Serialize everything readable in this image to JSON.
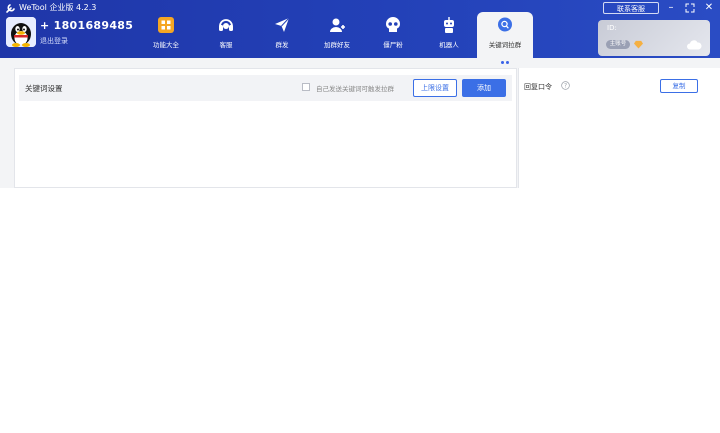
{
  "window": {
    "title": "WeTool 企业版 4.2.3",
    "contact_button": "联系客服",
    "controls": [
      "minimize",
      "maximize",
      "close"
    ]
  },
  "user": {
    "phone": "+ 1801689485",
    "logout_label": "退出登录"
  },
  "nav": {
    "items": [
      {
        "label": "功能大全",
        "icon": "grid-icon"
      },
      {
        "label": "客服",
        "icon": "headset-icon"
      },
      {
        "label": "群发",
        "icon": "paper-plane-icon"
      },
      {
        "label": "加群好友",
        "icon": "add-user-icon"
      },
      {
        "label": "僵尸粉",
        "icon": "skull-icon"
      },
      {
        "label": "机器人",
        "icon": "robot-icon"
      },
      {
        "label": "关键词拉群",
        "icon": "keyword-chat-icon",
        "active": true
      }
    ]
  },
  "account": {
    "id_label": "ID:",
    "badge": "主账号"
  },
  "keyword_panel": {
    "title": "关键词设置",
    "checkbox_label": "自己发送关键词可触发拉群",
    "checkbox_checked": false,
    "limit_button": "上限设置",
    "add_button": "添加"
  },
  "reply_panel": {
    "label": "回复口令",
    "copy_button": "复制"
  },
  "colors": {
    "header_blue": "#2341b8",
    "accent": "#3b6fe6"
  }
}
